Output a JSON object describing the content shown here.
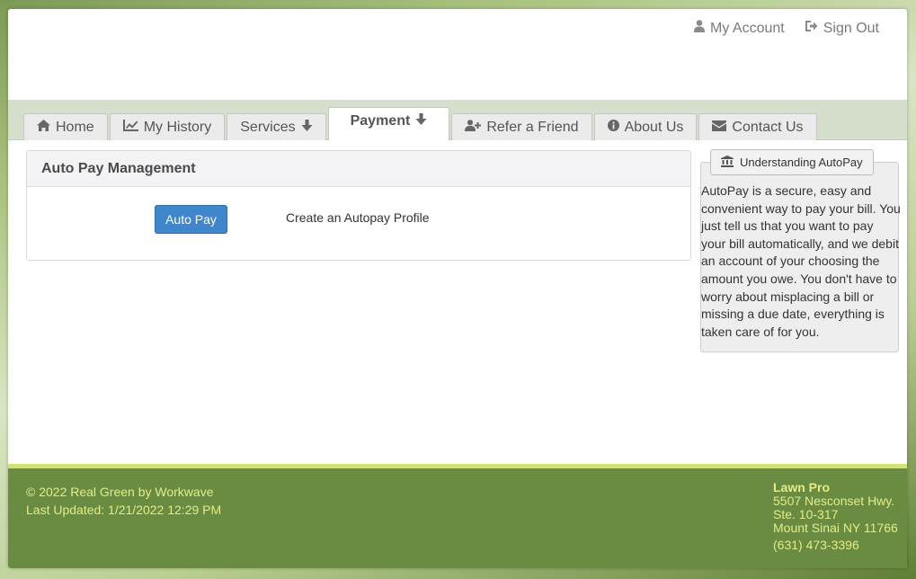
{
  "header": {
    "my_account": "My Account",
    "sign_out": "Sign Out"
  },
  "tabs": [
    {
      "label": "Home",
      "icon": "home-icon"
    },
    {
      "label": "My History",
      "icon": "chart-line-icon"
    },
    {
      "label": "Services",
      "icon": "arrow-down-icon"
    },
    {
      "label": "Payment",
      "icon": "arrow-down-icon",
      "active": true
    },
    {
      "label": "Refer a Friend",
      "icon": "user-plus-icon"
    },
    {
      "label": "About Us",
      "icon": "info-circle-icon"
    },
    {
      "label": "Contact Us",
      "icon": "envelope-icon"
    }
  ],
  "panel": {
    "title": "Auto Pay Management",
    "button_label": "Auto Pay",
    "description": "Create an Autopay Profile"
  },
  "sidebar": {
    "legend": "Understanding AutoPay",
    "text": "AutoPay is a secure, easy and convenient way to pay your bill. You just tell us that you want to pay your bill automatically, and we debit an account of your choosing the amount you owe. You don't have to worry about misplacing a bill or missing a due date, everything is taken care of for you."
  },
  "footer": {
    "copyright": "© 2022 Real Green by Workwave",
    "last_updated": "Last Updated: 1/21/2022 12:29 PM",
    "company": "Lawn Pro",
    "address1": "5507 Nesconset Hwy.",
    "address2": "Ste. 10-317",
    "city": "Mount Sinai NY 11766",
    "phone": "(631) 473-3396"
  },
  "colors": {
    "accent_button": "#3f86cc",
    "footer_bg": "#6a8b42",
    "footer_text": "#e3ec86",
    "nav_band": "#d5dfcc"
  }
}
